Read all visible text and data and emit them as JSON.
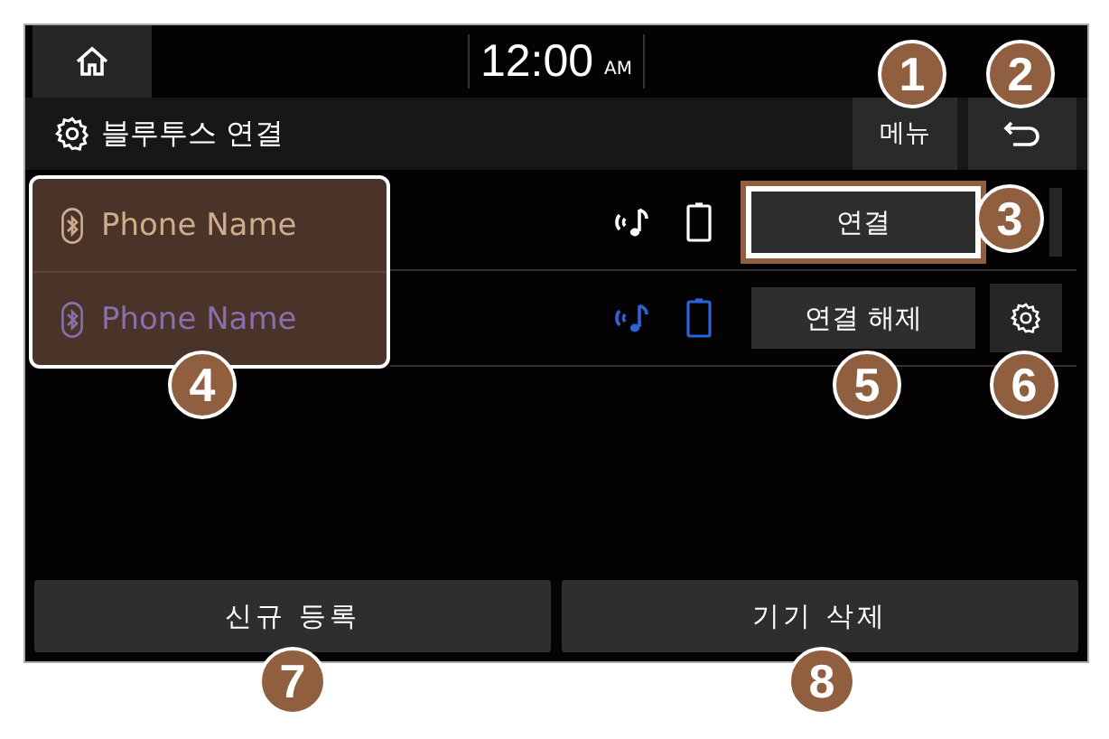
{
  "status_bar": {
    "time": "12:00",
    "meridiem": "AM"
  },
  "title_bar": {
    "title": "블루투스 연결",
    "menu_button": "메뉴"
  },
  "device_list": {
    "highlighted": true,
    "devices": [
      {
        "name": "Phone Name",
        "connected": false,
        "action": "연결",
        "action_highlighted": true
      },
      {
        "name": "Phone Name",
        "connected": true,
        "action": "연결 해제",
        "action_highlighted": false
      }
    ]
  },
  "bottom_buttons": [
    "신규 등록",
    "기기 삭제"
  ],
  "callouts": [
    "1",
    "2",
    "3",
    "4",
    "5",
    "6",
    "7",
    "8"
  ]
}
